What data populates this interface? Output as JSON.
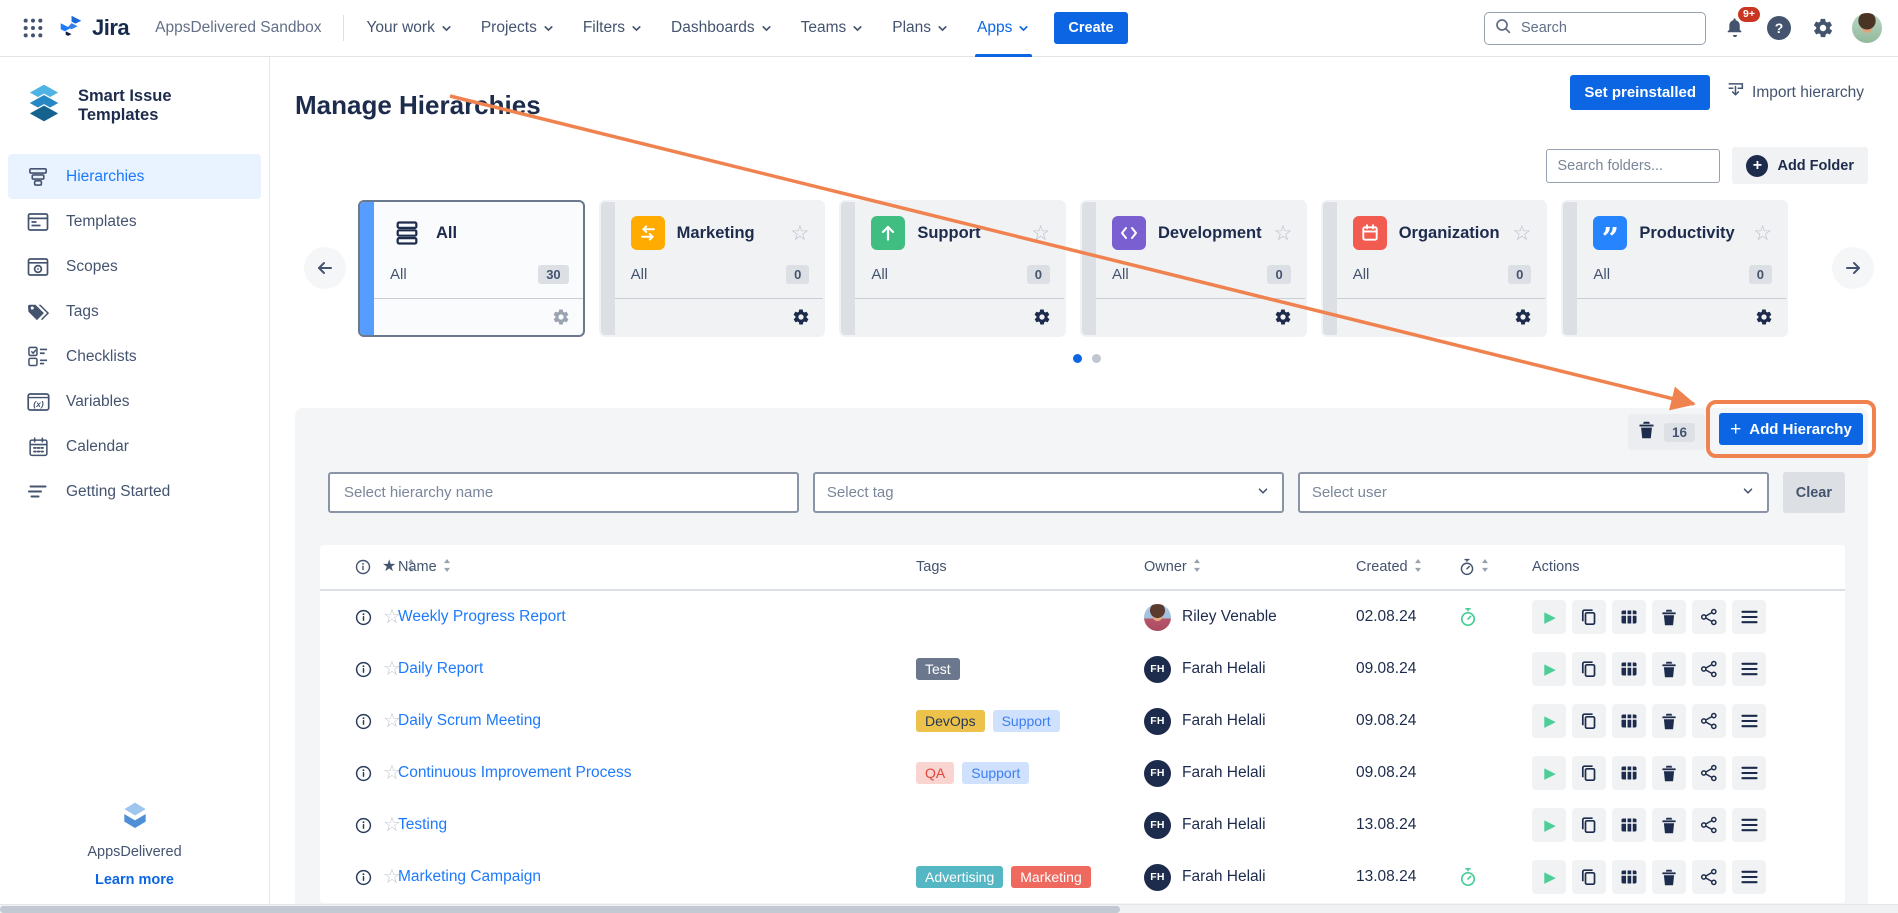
{
  "topnav": {
    "logo_text": "Jira",
    "site_name": "AppsDelivered Sandbox",
    "menus": [
      {
        "label": "Your work"
      },
      {
        "label": "Projects"
      },
      {
        "label": "Filters"
      },
      {
        "label": "Dashboards"
      },
      {
        "label": "Teams"
      },
      {
        "label": "Plans"
      },
      {
        "label": "Apps",
        "active": true
      }
    ],
    "create_label": "Create",
    "search_placeholder": "Search",
    "notifications_badge": "9+"
  },
  "sidebar": {
    "app_title": "Smart Issue Templates",
    "items": [
      {
        "label": "Hierarchies",
        "icon": "hierarchies-icon",
        "active": true
      },
      {
        "label": "Templates",
        "icon": "templates-icon"
      },
      {
        "label": "Scopes",
        "icon": "scopes-icon"
      },
      {
        "label": "Tags",
        "icon": "tags-icon"
      },
      {
        "label": "Checklists",
        "icon": "checklists-icon"
      },
      {
        "label": "Variables",
        "icon": "variables-icon"
      },
      {
        "label": "Calendar",
        "icon": "calendar-icon"
      },
      {
        "label": "Getting Started",
        "icon": "getting-started-icon"
      }
    ],
    "footer": {
      "brand": "AppsDelivered",
      "link": "Learn more"
    }
  },
  "page": {
    "title": "Manage Hierarchies",
    "set_preinstalled": "Set preinstalled",
    "import_hierarchy": "Import hierarchy"
  },
  "folders": {
    "search_placeholder": "Search folders...",
    "add_folder_label": "Add Folder",
    "cards": [
      {
        "name": "All",
        "scope": "All",
        "count": "30",
        "icon": "stack-icon",
        "icon_bg": "",
        "selected": true,
        "has_star": false
      },
      {
        "name": "Marketing",
        "scope": "All",
        "count": "0",
        "icon": "transfer-icon",
        "icon_bg": "#FFAB00",
        "has_star": true
      },
      {
        "name": "Support",
        "scope": "All",
        "count": "0",
        "icon": "arrow-up-icon",
        "icon_bg": "#40BE82",
        "has_star": true
      },
      {
        "name": "Development",
        "scope": "All",
        "count": "0",
        "icon": "code-icon",
        "icon_bg": "#7A5FD0",
        "has_star": true
      },
      {
        "name": "Organization",
        "scope": "All",
        "count": "0",
        "icon": "calendar-red-icon",
        "icon_bg": "#F15B50",
        "has_star": true
      },
      {
        "name": "Productivity",
        "scope": "All",
        "count": "0",
        "icon": "quote-icon",
        "icon_bg": "#2684FF",
        "has_star": true
      }
    ],
    "pagination": {
      "total": 2,
      "active": 0
    }
  },
  "toolbar": {
    "trash_count": "16",
    "add_hierarchy_label": "Add Hierarchy"
  },
  "filters": {
    "name_placeholder": "Select hierarchy name",
    "tag_placeholder": "Select tag",
    "user_placeholder": "Select user",
    "clear_label": "Clear"
  },
  "table": {
    "headers": {
      "name": "Name",
      "tags": "Tags",
      "owner": "Owner",
      "created": "Created",
      "actions": "Actions"
    },
    "row_actions": [
      "run",
      "copy",
      "table",
      "delete",
      "share",
      "menu"
    ],
    "rows": [
      {
        "name": "Weekly Progress Report",
        "tags": [],
        "owner": "Riley Venable",
        "avatar": "photo",
        "initials": "",
        "created": "02.08.24",
        "timer": true
      },
      {
        "name": "Daily Report",
        "tags": [
          {
            "label": "Test",
            "bg": "#6B778C",
            "fg": "#FFFFFF"
          }
        ],
        "owner": "Farah Helali",
        "avatar": "initials",
        "initials": "FH",
        "created": "09.08.24",
        "timer": false
      },
      {
        "name": "Daily Scrum Meeting",
        "tags": [
          {
            "label": "DevOps",
            "bg": "#ECC24A",
            "fg": "#243757"
          },
          {
            "label": "Support",
            "bg": "#CFE1FD",
            "fg": "#3C7EF3"
          }
        ],
        "owner": "Farah Helali",
        "avatar": "initials",
        "initials": "FH",
        "created": "09.08.24",
        "timer": false
      },
      {
        "name": "Continuous Improvement Process",
        "tags": [
          {
            "label": "QA",
            "bg": "#FAD4D0",
            "fg": "#E0473C"
          },
          {
            "label": "Support",
            "bg": "#CFE1FD",
            "fg": "#3C7EF3"
          }
        ],
        "owner": "Farah Helali",
        "avatar": "initials",
        "initials": "FH",
        "created": "09.08.24",
        "timer": false
      },
      {
        "name": "Testing",
        "tags": [],
        "owner": "Farah Helali",
        "avatar": "initials",
        "initials": "FH",
        "created": "13.08.24",
        "timer": false
      },
      {
        "name": "Marketing Campaign",
        "tags": [
          {
            "label": "Advertising",
            "bg": "#54B7C3",
            "fg": "#FFFFFF"
          },
          {
            "label": "Marketing",
            "bg": "#EF6A5E",
            "fg": "#FFFFFF"
          }
        ],
        "owner": "Farah Helali",
        "avatar": "initials",
        "initials": "FH",
        "created": "13.08.24",
        "timer": true
      }
    ]
  },
  "colors": {
    "accent": "#0C66E4",
    "annotation": "#F0824F",
    "link": "#1D7AFC",
    "timer_green": "#4BCE97",
    "selected_stripe": "#579DFF"
  }
}
